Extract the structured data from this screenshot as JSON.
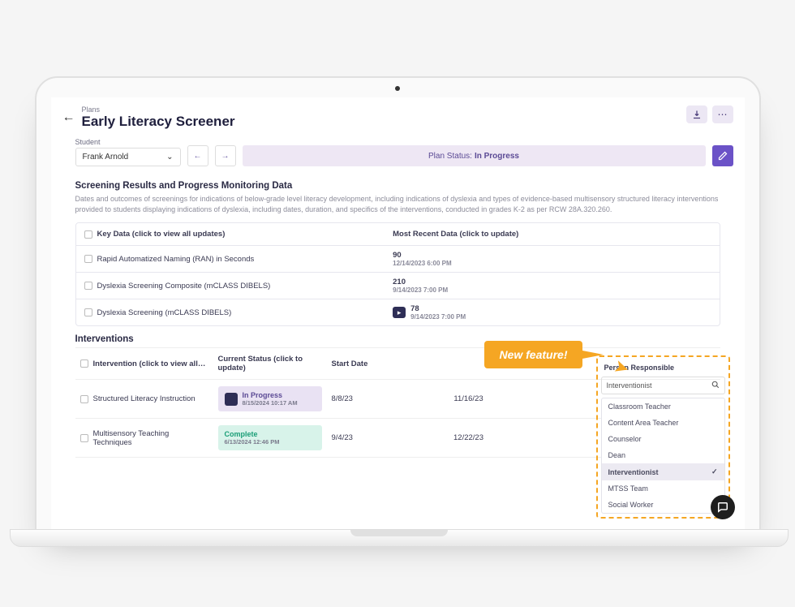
{
  "breadcrumb": "Plans",
  "page_title": "Early Literacy Screener",
  "student": {
    "label": "Student",
    "value": "Frank Arnold"
  },
  "plan_status": {
    "prefix": "Plan Status:",
    "value": "In Progress"
  },
  "screening": {
    "title": "Screening Results and Progress Monitoring Data",
    "desc": "Dates and outcomes of screenings for indications of below-grade level literacy development, including indications of dyslexia and types of evidence-based multisensory structured literacy interventions provided to students displaying indications of dyslexia, including dates, duration, and specifics of the interventions, conducted in grades K-2 as per RCW 28A.320.260.",
    "col_key": "Key Data (click to view all updates)",
    "col_recent": "Most Recent Data (click to update)",
    "rows": [
      {
        "key": "Rapid Automatized Naming (RAN) in Seconds",
        "recent_value": "90",
        "recent_ts": "12/14/2023 6:00 PM",
        "badge": false
      },
      {
        "key": "Dyslexia Screening Composite (mCLASS DIBELS)",
        "recent_value": "210",
        "recent_ts": "9/14/2023 7:00 PM",
        "badge": false
      },
      {
        "key": "Dyslexia Screening (mCLASS DIBELS)",
        "recent_value": "78",
        "recent_ts": "9/14/2023 7:00 PM",
        "badge": true
      }
    ]
  },
  "interventions": {
    "title": "Interventions",
    "col_intervention": "Intervention (click to view all…",
    "col_status": "Current Status (click to update)",
    "col_start": "Start Date",
    "rows": [
      {
        "name": "Structured Literacy Instruction",
        "status": "In Progress",
        "status_kind": "inprogress",
        "status_ts": "8/15/2024 10:17 AM",
        "start": "8/8/23",
        "end": "11/16/23"
      },
      {
        "name": "Multisensory Teaching Techniques",
        "status": "Complete",
        "status_kind": "complete",
        "status_ts": "6/13/2024 12:46 PM",
        "start": "9/4/23",
        "end": "12/22/23"
      }
    ]
  },
  "person": {
    "header": "Person Responsible",
    "value": "Interventionist",
    "options": [
      "Classroom Teacher",
      "Content Area Teacher",
      "Counselor",
      "Dean",
      "Interventionist",
      "MTSS Team",
      "Social Worker"
    ],
    "selected": "Interventionist"
  },
  "callout": "New feature!"
}
